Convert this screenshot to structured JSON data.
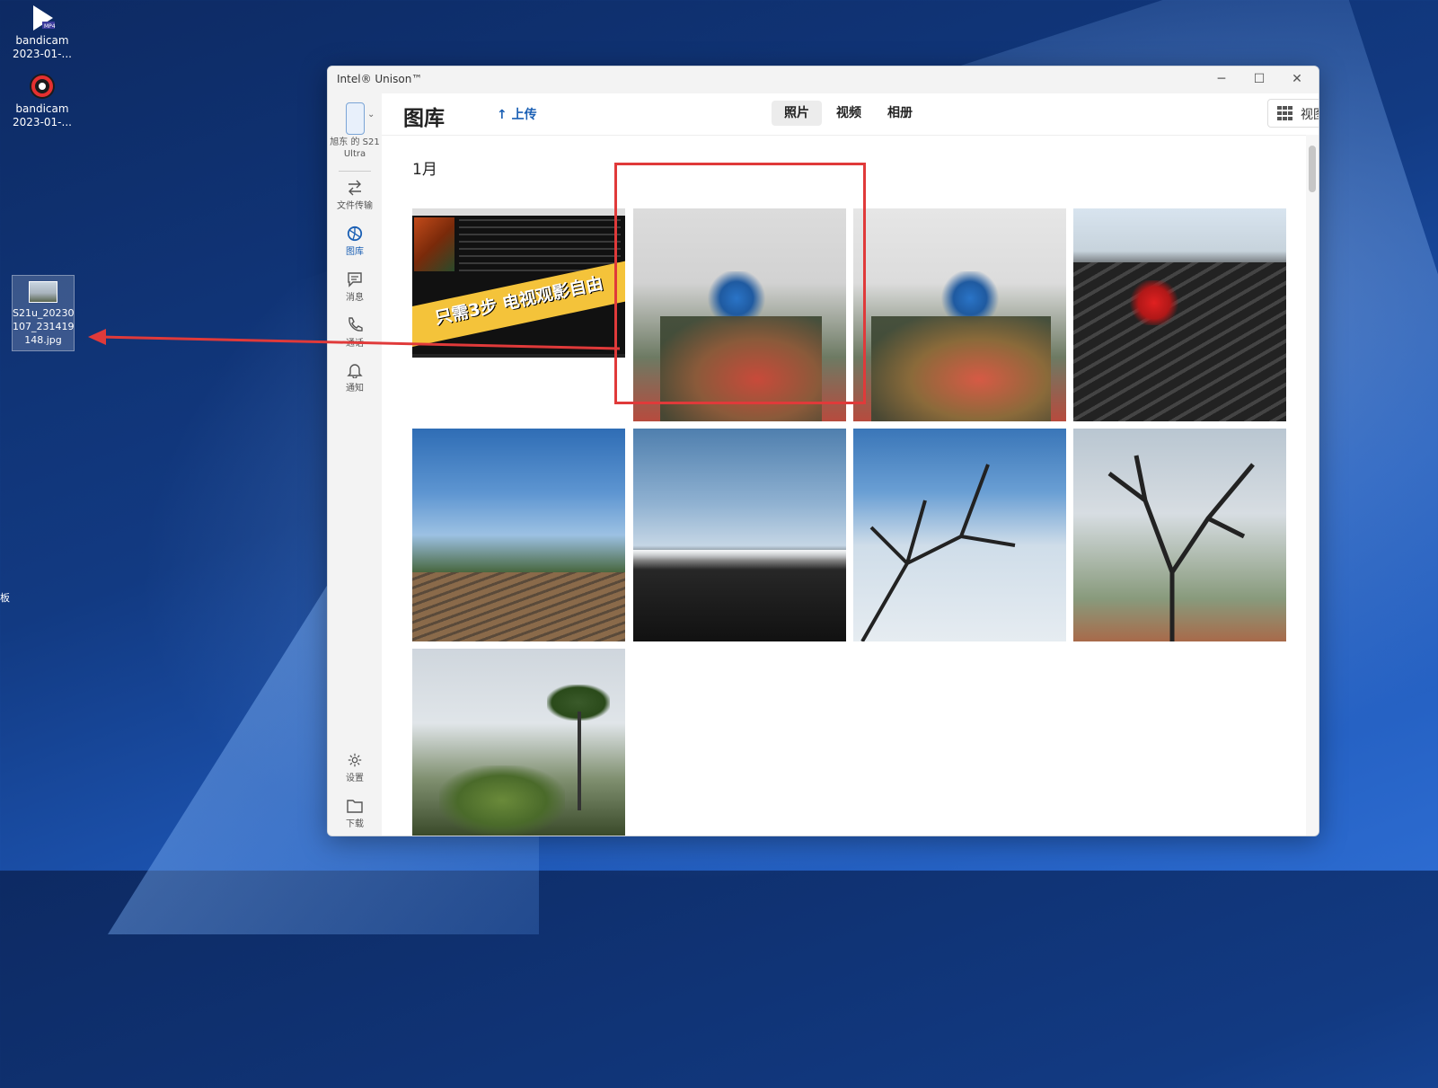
{
  "desktop": {
    "icons": [
      {
        "label": "bandicam\n2023-01-..."
      },
      {
        "label": "bandicam\n2023-01-..."
      },
      {
        "label": "S21u_20230\n107_231419\n148.jpg"
      }
    ],
    "cut_text": [
      "板"
    ]
  },
  "window": {
    "title": "Intel® Unison™",
    "controls": {
      "minimize": "─",
      "maximize": "☐",
      "close": "✕"
    }
  },
  "sidebar": {
    "device_label": "旭东 的 S21 Ultra",
    "items": [
      {
        "label": "文件传输",
        "icon": "transfer-icon"
      },
      {
        "label": "图库",
        "icon": "gallery-icon",
        "active": true
      },
      {
        "label": "消息",
        "icon": "message-icon"
      },
      {
        "label": "通话",
        "icon": "phone-icon"
      },
      {
        "label": "通知",
        "icon": "bell-icon"
      }
    ],
    "bottom_items": [
      {
        "label": "设置",
        "icon": "gear-icon"
      },
      {
        "label": "下载",
        "icon": "folder-icon"
      }
    ]
  },
  "header": {
    "title": "图库",
    "upload_label": "上传",
    "tabs": [
      {
        "label": "照片",
        "selected": true
      },
      {
        "label": "视频"
      },
      {
        "label": "相册"
      }
    ],
    "view_label": "视图"
  },
  "gallery": {
    "month": "1月",
    "banner_text": "只需3步 电视观影自由",
    "photos": [
      {
        "subject": "tv-screen"
      },
      {
        "subject": "flowers-1"
      },
      {
        "subject": "flowers-2"
      },
      {
        "subject": "roof-flowers"
      },
      {
        "subject": "trees-roof"
      },
      {
        "subject": "mountains-clouds"
      },
      {
        "subject": "branches-sky"
      },
      {
        "subject": "bare-tree-fog"
      },
      {
        "subject": "pine-fog"
      }
    ]
  },
  "colors": {
    "accent": "#1a5fb4",
    "annotation": "#e03a3a"
  }
}
